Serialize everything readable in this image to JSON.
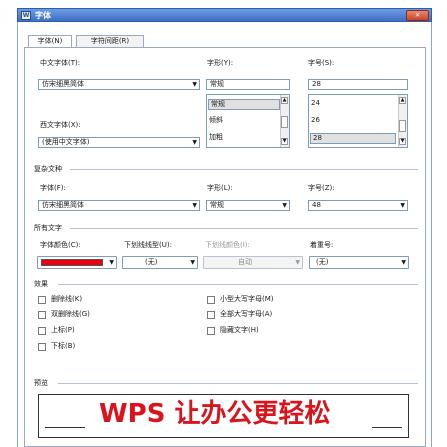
{
  "window": {
    "title": "字体",
    "close_label": "×"
  },
  "tabs": [
    {
      "label": "字体(N)"
    },
    {
      "label": "字符间距(R)"
    }
  ],
  "font": {
    "chinese_label": "中文字体(T):",
    "chinese_value": "仿宋细黑简体",
    "western_label": "西文字体(X):",
    "western_value": "(使用中文字体)",
    "style_label": "字形(Y):",
    "style_value": "常规",
    "style_options": [
      "常规",
      "倾斜",
      "加粗"
    ],
    "size_label": "字号(S):",
    "size_value": "28",
    "size_options": [
      "24",
      "26",
      "28"
    ]
  },
  "complex": {
    "section_label": "复杂文种",
    "font_label": "字体(F):",
    "font_value": "仿宋细黑简体",
    "style_label": "字形(L):",
    "style_value": "常规",
    "size_label": "字号(Z):",
    "size_value": "48"
  },
  "all_text": {
    "section_label": "所有文字",
    "color_label": "字体颜色(C):",
    "color_value": "#e60012",
    "underline_label": "下划线线型(U):",
    "underline_value": "(无)",
    "underline_color_label": "下划线颜色(I):",
    "underline_color_value": "自动",
    "emphasis_label": "着重号:",
    "emphasis_value": "(无)"
  },
  "effects": {
    "section_label": "效果",
    "left": [
      "删除线(K)",
      "双删除线(G)",
      "上标(P)",
      "下标(B)"
    ],
    "right": [
      "小型大写字母(M)",
      "全部大写字母(A)",
      "隐藏文字(H)"
    ]
  },
  "preview": {
    "section_label": "预览",
    "text": "WPS 让办公更轻松",
    "color": "#d9141c"
  }
}
